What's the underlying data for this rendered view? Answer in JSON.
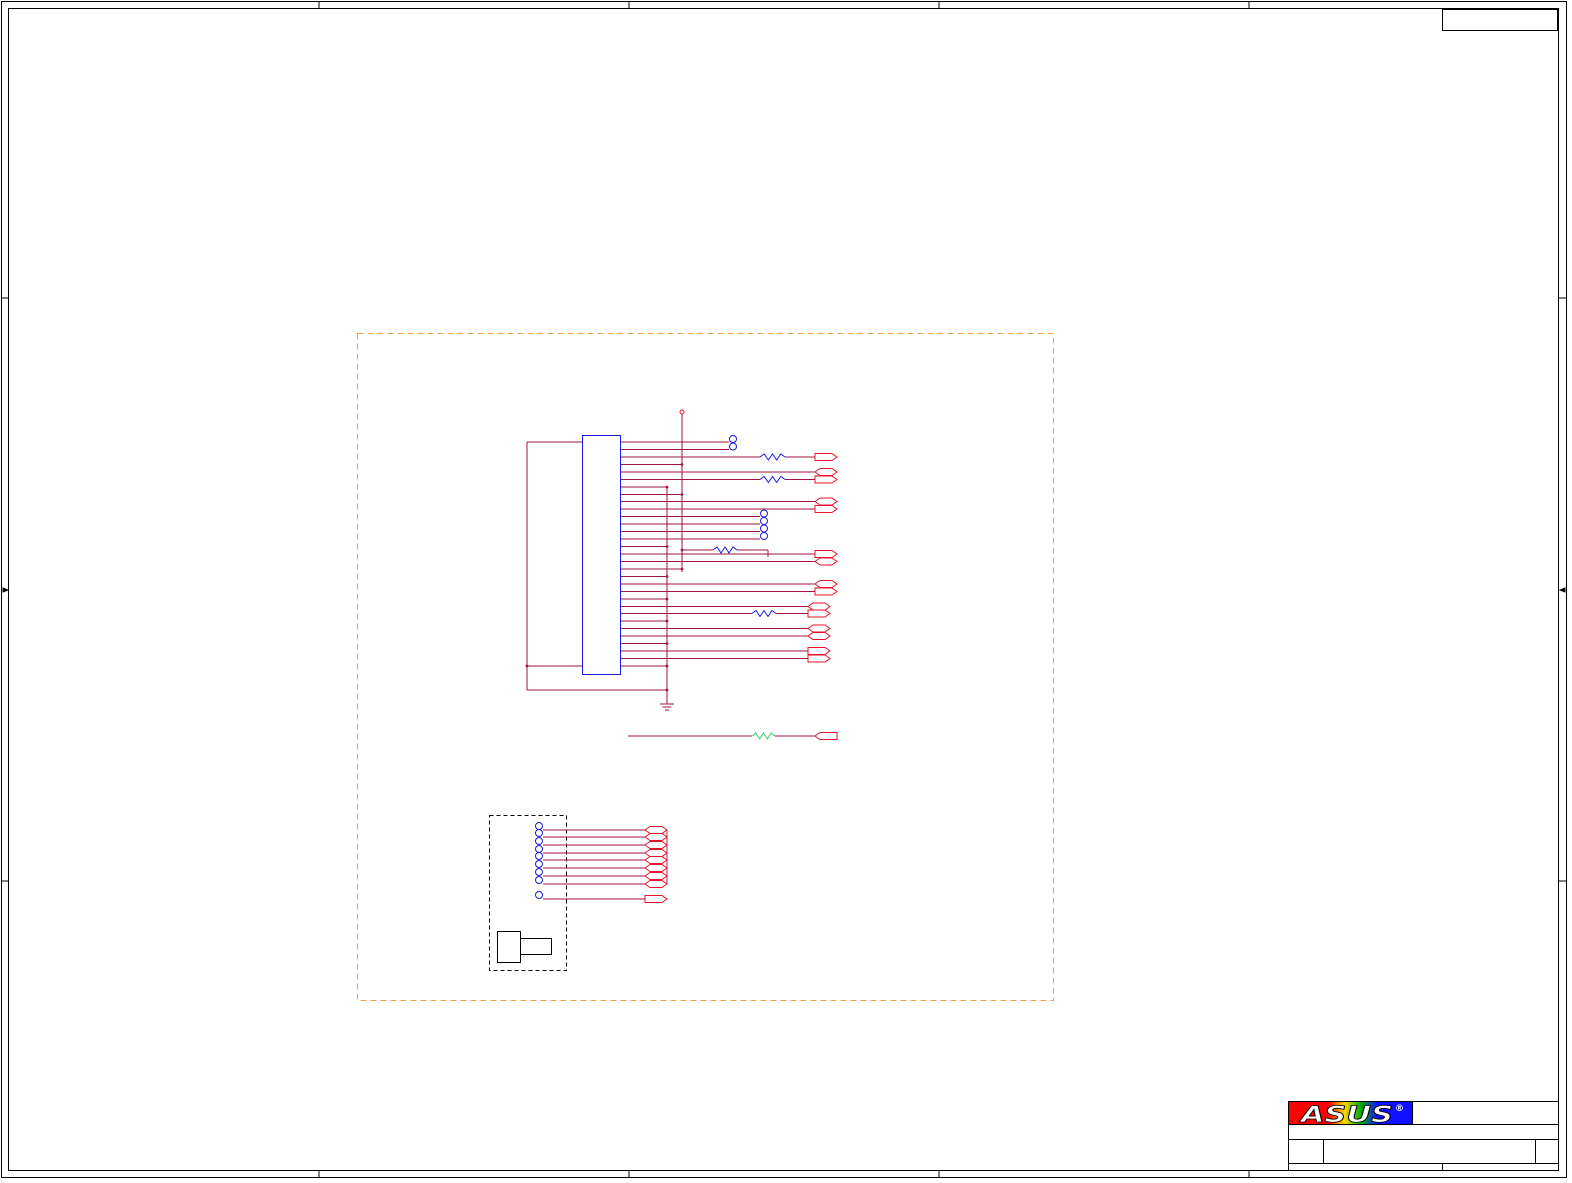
{
  "logo": {
    "text": "ASUS",
    "registered": "®"
  },
  "colors": {
    "frame": "#000000",
    "wire": "#a3133f",
    "pin": "#e8102a",
    "component": "#1a1ae6",
    "boundary": "#f5a040",
    "resistor_alt": "#3ad06a",
    "logo_red": "#ff0000",
    "logo_yellow": "#ffd800",
    "logo_green": "#00b000",
    "logo_blue": "#1010ff"
  },
  "icons": {
    "ground": "ground-icon",
    "power": "power-node-icon",
    "test_point": "test-point-icon",
    "resistor": "resistor-icon",
    "off_page": "off-page-connector-icon"
  }
}
